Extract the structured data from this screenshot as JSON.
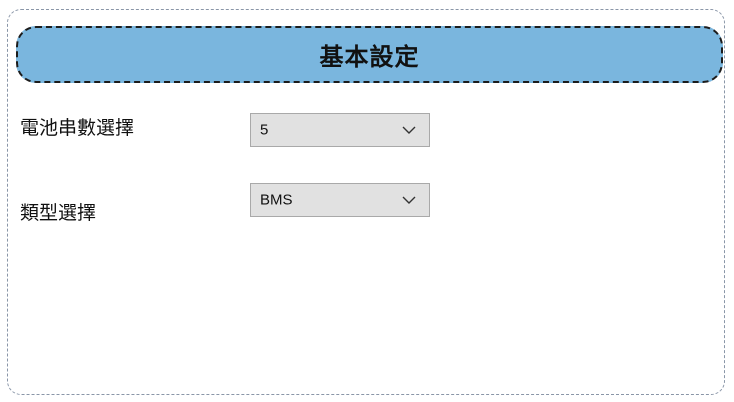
{
  "header": {
    "title": "基本設定",
    "accent_color": "#7ab6de"
  },
  "fields": [
    {
      "label": "電池串數選擇",
      "value": "5",
      "icon": "chevron-down-icon"
    },
    {
      "label": "類型選擇",
      "value": "BMS",
      "icon": "chevron-down-icon"
    }
  ]
}
